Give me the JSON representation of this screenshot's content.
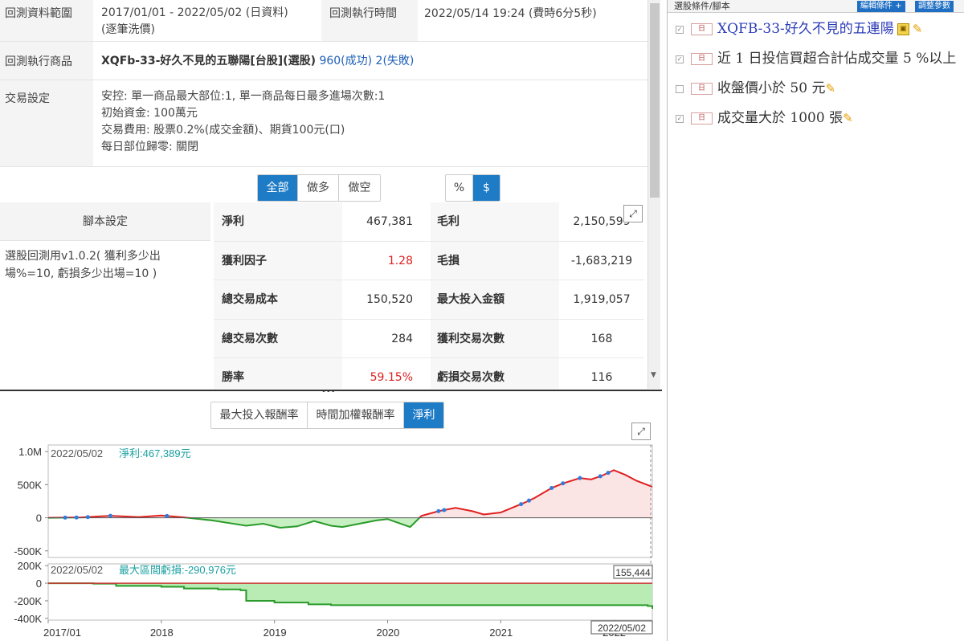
{
  "info": {
    "range_label": "回測資料範圍",
    "range_value": "2017/01/01 - 2022/05/02 (日資料)",
    "range_note": "(逐筆洗價)",
    "exec_time_label": "回測執行時間",
    "exec_time_value": "2022/05/14 19:24 (費時6分5秒)",
    "product_label": "回測執行商品",
    "product_value": "XQFb-33-好久不見的五聯陽[台股](選股)",
    "product_success": "960(成功)",
    "product_fail": "2(失敗)",
    "trade_label": "交易設定",
    "trade_lines": [
      "安控: 單一商品最大部位:1, 單一商品每日最多進場次數:1",
      "初始資金: 100萬元",
      "交易費用: 股票0.2%(成交金額)、期貨100元(口)",
      "每日部位歸零: 關閉"
    ]
  },
  "filter_tabs": [
    "全部",
    "做多",
    "做空"
  ],
  "unit_tabs": [
    "%",
    "$"
  ],
  "script": {
    "header": "腳本設定",
    "body_line1": "選股回測用v1.0.2( 獲利多少出",
    "body_line2": "場%=10, 虧損多少出場=10 )"
  },
  "stats": [
    {
      "k1": "淨利",
      "v1": "467,381",
      "k2": "毛利",
      "v2": "2,150,599",
      "red": false
    },
    {
      "k1": "獲利因子",
      "v1": "1.28",
      "k2": "毛損",
      "v2": "-1,683,219",
      "red": true
    },
    {
      "k1": "總交易成本",
      "v1": "150,520",
      "k2": "最大投入金額",
      "v2": "1,919,057",
      "red": false
    },
    {
      "k1": "總交易次數",
      "v1": "284",
      "k2": "獲利交易次數",
      "v2": "168",
      "red": false
    },
    {
      "k1": "勝率",
      "v1": "59.15%",
      "k2": "虧損交易次數",
      "v2": "116",
      "red": true
    }
  ],
  "chart_tabs": [
    "最大投入報酬率",
    "時間加權報酬率",
    "淨利"
  ],
  "chart_data": [
    {
      "type": "area",
      "header_date": "2022/05/02",
      "header_label": "淨利:467,389元",
      "ylim": [
        -600000,
        1100000
      ],
      "ytick_labels": [
        "1.0M",
        "500K",
        "0",
        "-500K"
      ],
      "ytick_values": [
        1000000,
        500000,
        0,
        -500000
      ],
      "x_labels": [
        "2017/01",
        "2018",
        "2019",
        "2020",
        "2021",
        "2022"
      ],
      "x_values": [
        2017.0,
        2018.0,
        2019.0,
        2020.0,
        2021.0,
        2022.0
      ],
      "x": [
        2017.0,
        2017.3,
        2017.55,
        2017.8,
        2018.0,
        2018.2,
        2018.45,
        2018.6,
        2018.75,
        2018.9,
        2019.05,
        2019.2,
        2019.35,
        2019.5,
        2019.6,
        2019.75,
        2019.9,
        2020.0,
        2020.1,
        2020.2,
        2020.3,
        2020.45,
        2020.6,
        2020.75,
        2020.85,
        2021.0,
        2021.1,
        2021.2,
        2021.3,
        2021.45,
        2021.55,
        2021.7,
        2021.8,
        2021.9,
        2022.0,
        2022.1,
        2022.2,
        2022.34
      ],
      "y": [
        0,
        5000,
        30000,
        10000,
        35000,
        5000,
        -40000,
        -80000,
        -120000,
        -90000,
        -150000,
        -130000,
        -50000,
        -120000,
        -140000,
        -90000,
        -40000,
        -20000,
        -80000,
        -140000,
        30000,
        100000,
        150000,
        100000,
        50000,
        80000,
        150000,
        220000,
        300000,
        450000,
        520000,
        600000,
        580000,
        640000,
        720000,
        650000,
        560000,
        467389
      ],
      "pos_color": "#e02020",
      "neg_color": "#2a9a2a",
      "mark_color": "#2b7de0"
    },
    {
      "type": "area",
      "header_date": "2022/05/02",
      "header_label": "最大區間虧損:-290,976元",
      "right_badge": "155,444",
      "bottom_badge": "2022/05/02",
      "ylim": [
        -420000,
        220000
      ],
      "ytick_labels": [
        "200K",
        "0",
        "-200K",
        "-400K"
      ],
      "ytick_values": [
        200000,
        0,
        -200000,
        -400000
      ],
      "x": [
        2017.0,
        2017.4,
        2017.6,
        2018.0,
        2018.2,
        2018.5,
        2018.7,
        2018.75,
        2019.0,
        2019.3,
        2019.5,
        2020.0,
        2020.5,
        2021.0,
        2021.5,
        2022.0,
        2022.3,
        2022.34
      ],
      "y": [
        0,
        -5000,
        -30000,
        -40000,
        -60000,
        -70000,
        -80000,
        -200000,
        -220000,
        -240000,
        -250000,
        -250000,
        -250000,
        -250000,
        -250000,
        -250000,
        -260000,
        -290976
      ],
      "line_color": "#2a9a2a",
      "fill_color": "#b8ecb4"
    }
  ],
  "right": {
    "header": "選股條件/腳本",
    "btn_edit": "編輯條件 +",
    "btn_adjust": "調整參數",
    "conditions": [
      {
        "text": "XQFB-33-好久不見的五連陽",
        "checked": true
      },
      {
        "text": "近 1 日投信買超合計佔成交量 5 %以上",
        "checked": true
      },
      {
        "text": "收盤價小於 50 元",
        "checked": false
      },
      {
        "text": "成交量大於 1000 張",
        "checked": true
      }
    ],
    "tag_label": "日"
  }
}
